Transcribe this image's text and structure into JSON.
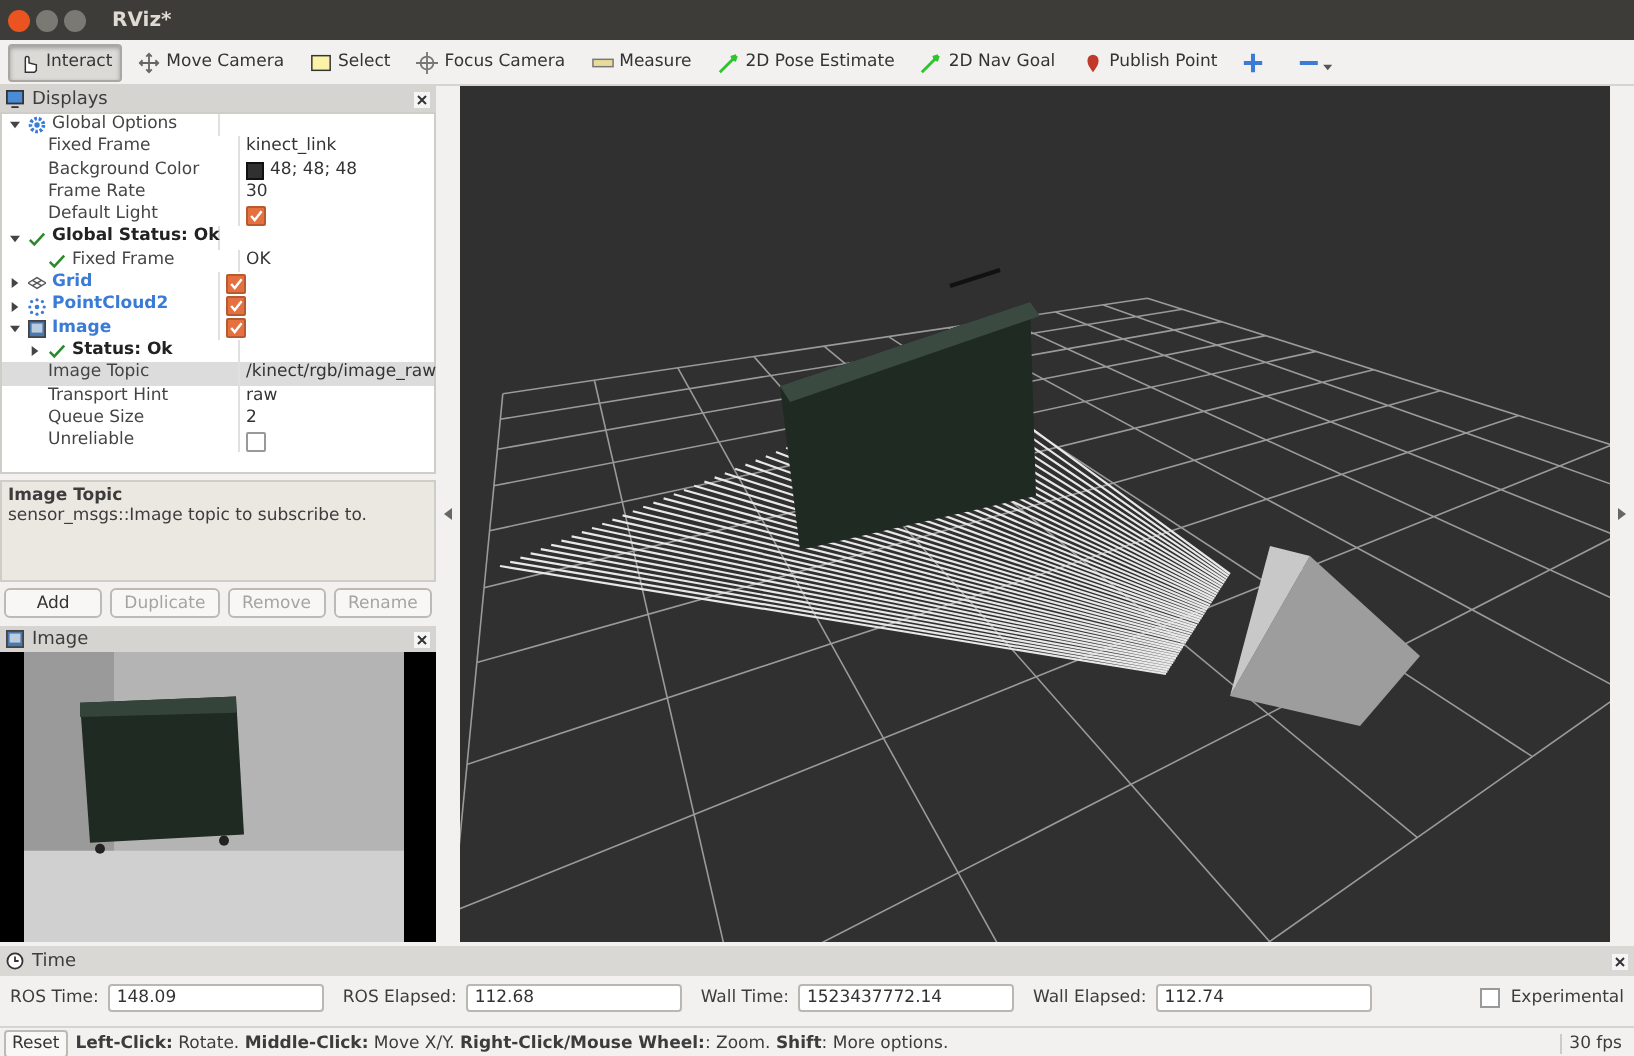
{
  "window": {
    "title": "RViz*"
  },
  "toolbar": [
    {
      "label": "Interact",
      "kind": "interact",
      "selected": true
    },
    {
      "label": "Move Camera",
      "kind": "move",
      "selected": false
    },
    {
      "label": "Select",
      "kind": "select",
      "selected": false
    },
    {
      "label": "Focus Camera",
      "kind": "focus",
      "selected": false
    },
    {
      "label": "Measure",
      "kind": "measure",
      "selected": false
    },
    {
      "label": "2D Pose Estimate",
      "kind": "pose",
      "selected": false
    },
    {
      "label": "2D Nav Goal",
      "kind": "pose",
      "selected": false
    },
    {
      "label": "Publish Point",
      "kind": "point",
      "selected": false
    }
  ],
  "displays": {
    "title": "Displays",
    "tree": [
      {
        "label": "Global Options",
        "kind": "group",
        "expanded": true,
        "selected": false,
        "children": [
          {
            "label": "Fixed Frame",
            "kind": "property",
            "value": "kinect_link",
            "selected": false
          },
          {
            "label": "Background Color",
            "kind": "property",
            "value": "48; 48; 48",
            "color": "#303030",
            "selected": false
          },
          {
            "label": "Frame Rate",
            "kind": "property",
            "value": "30",
            "selected": false
          },
          {
            "label": "Default Light",
            "kind": "property",
            "checked": true,
            "selected": false
          }
        ]
      },
      {
        "label": "Global Status: Ok",
        "kind": "status",
        "expanded": true,
        "selected": false,
        "children": [
          {
            "label": "Fixed Frame",
            "kind": "status",
            "value": "OK",
            "selected": false
          }
        ]
      },
      {
        "label": "Grid",
        "kind": "grid",
        "expanded": false,
        "checked": true,
        "selected": false
      },
      {
        "label": "PointCloud2",
        "kind": "pointcloud",
        "expanded": false,
        "checked": true,
        "selected": false
      },
      {
        "label": "Image",
        "kind": "image",
        "expanded": true,
        "checked": true,
        "selected": false,
        "children": [
          {
            "label": "Status: Ok",
            "kind": "status",
            "expanded": false,
            "selected": false
          },
          {
            "label": "Image Topic",
            "kind": "property",
            "value": "/kinect/rgb/image_raw",
            "selected": true
          },
          {
            "label": "Transport Hint",
            "kind": "property",
            "value": "raw",
            "selected": false
          },
          {
            "label": "Queue Size",
            "kind": "property",
            "value": "2",
            "selected": false
          },
          {
            "label": "Unreliable",
            "kind": "property",
            "checked": false,
            "selected": false
          }
        ]
      }
    ],
    "description": {
      "title": "Image Topic",
      "text": "sensor_msgs::Image topic to subscribe to."
    },
    "buttons": [
      {
        "label": "Add",
        "disabled": false
      },
      {
        "label": "Duplicate",
        "disabled": true
      },
      {
        "label": "Remove",
        "disabled": true
      },
      {
        "label": "Rename",
        "disabled": true
      }
    ]
  },
  "image_panel": {
    "title": "Image"
  },
  "time": {
    "title": "Time",
    "fields": [
      {
        "label": "ROS Time:",
        "value": "148.09"
      },
      {
        "label": "ROS Elapsed:",
        "value": "112.68"
      },
      {
        "label": "Wall Time:",
        "value": "1523437772.14"
      },
      {
        "label": "Wall Elapsed:",
        "value": "112.74"
      }
    ],
    "experimental": {
      "label": "Experimental",
      "checked": false
    }
  },
  "status_bar": {
    "reset": "Reset",
    "hint": "**Left-Click:** Rotate. **Middle-Click:** Move X/Y. **Right-Click/Mouse Wheel:**: Zoom. **Shift**: More options.",
    "fps": "30 fps"
  }
}
